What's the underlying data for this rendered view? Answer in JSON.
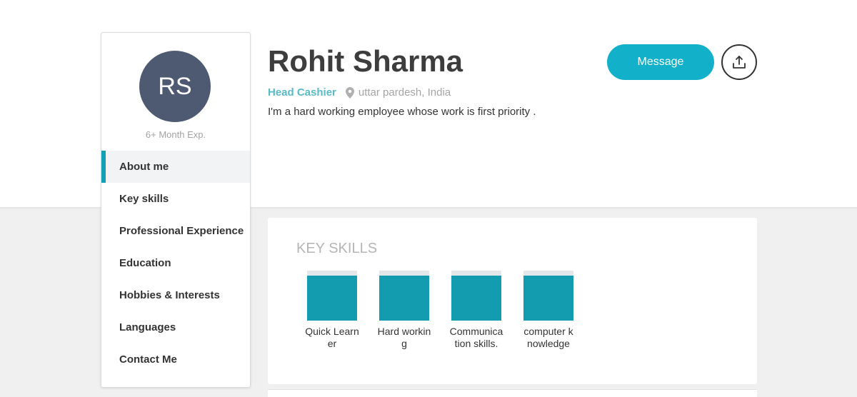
{
  "profile": {
    "initials": "RS",
    "experience": "6+ Month Exp.",
    "name": "Rohit Sharma",
    "job_title": "Head Cashier",
    "location": "uttar pardesh, India",
    "bio": "I'm a hard working employee whose work is first priority ."
  },
  "actions": {
    "message_label": "Message",
    "share_icon": "share-upload-icon"
  },
  "sidebar": {
    "items": [
      {
        "label": "About me",
        "active": true
      },
      {
        "label": "Key skills",
        "active": false
      },
      {
        "label": "Professional Experience",
        "active": false
      },
      {
        "label": "Education",
        "active": false
      },
      {
        "label": "Hobbies & Interests",
        "active": false
      },
      {
        "label": "Languages",
        "active": false
      },
      {
        "label": "Contact Me",
        "active": false
      }
    ]
  },
  "skills": {
    "heading": "KEY SKILLS",
    "items": [
      {
        "label": "Quick Learner"
      },
      {
        "label": "Hard working"
      },
      {
        "label": "Communication skills."
      },
      {
        "label": "computer knowledge"
      }
    ]
  },
  "colors": {
    "accent": "#13b1c9",
    "skill_block": "#139cb0",
    "avatar_bg": "#4e5a72",
    "job_title": "#5bbac8"
  }
}
